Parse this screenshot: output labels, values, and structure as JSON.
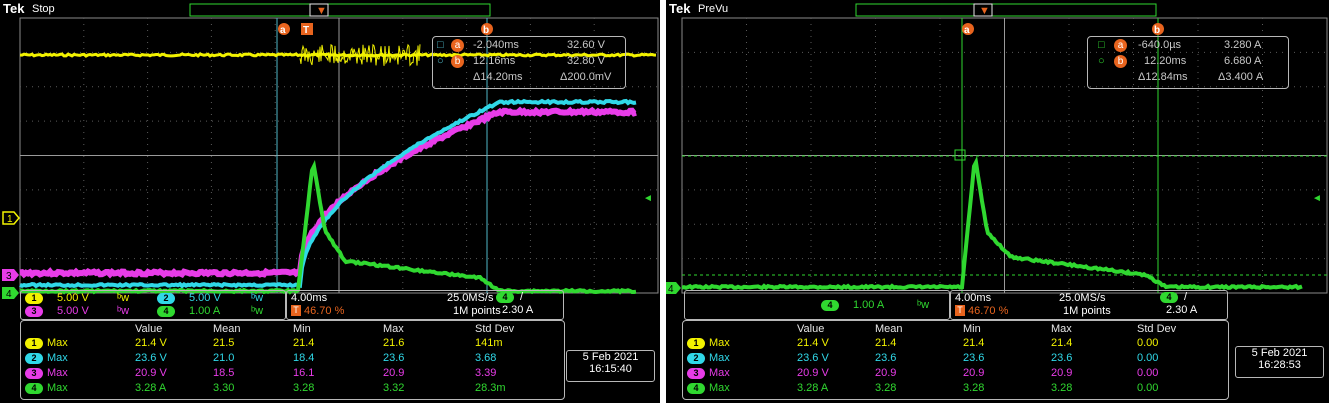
{
  "left": {
    "brand": "Tek",
    "acq_state": "Stop",
    "cursor_a": {
      "time": "-2.040ms",
      "value": "32.60 V"
    },
    "cursor_b": {
      "time": "12.16ms",
      "value": "32.80 V"
    },
    "cursor_delta": {
      "time": "Δ14.20ms",
      "value": "Δ200.0mV"
    },
    "ch_scales": [
      {
        "ch": "1",
        "label": "5.00 V",
        "color": "#f2f200"
      },
      {
        "ch": "2",
        "label": "5.00 V",
        "color": "#30d8e8"
      },
      {
        "ch": "3",
        "label": "5.00 V",
        "color": "#e83ce8"
      },
      {
        "ch": "4",
        "label": "1.00 A",
        "color": "#30d830"
      }
    ],
    "timebase": "4.00ms",
    "trigger_pos": "46.70 %",
    "sample_rate": "25.0MS/s",
    "record_length": "1M points",
    "trigger_ch": "4",
    "trigger_level": "2.30 A",
    "meas_headers": [
      "Value",
      "Mean",
      "Min",
      "Max",
      "Std Dev"
    ],
    "meas_rows": [
      {
        "ch": "1",
        "type": "Max",
        "value": "21.4 V",
        "mean": "21.5",
        "min": "21.4",
        "max": "21.6",
        "std": "141m",
        "color": "#f2f200"
      },
      {
        "ch": "2",
        "type": "Max",
        "value": "23.6 V",
        "mean": "21.0",
        "min": "18.4",
        "max": "23.6",
        "std": "3.68",
        "color": "#30d8e8"
      },
      {
        "ch": "3",
        "type": "Max",
        "value": "20.9 V",
        "mean": "18.5",
        "min": "16.1",
        "max": "20.9",
        "std": "3.39",
        "color": "#e83ce8"
      },
      {
        "ch": "4",
        "type": "Max",
        "value": "3.28 A",
        "mean": "3.30",
        "min": "3.28",
        "max": "3.32",
        "std": "28.3m",
        "color": "#30d830"
      }
    ],
    "date": "5 Feb  2021",
    "time": "16:15:40"
  },
  "right": {
    "brand": "Tek",
    "acq_state": "PreVu",
    "cursor_a": {
      "time": "-640.0µs",
      "value": "3.280 A"
    },
    "cursor_b": {
      "time": "12.20ms",
      "value": "6.680 A"
    },
    "cursor_delta": {
      "time": "Δ12.84ms",
      "value": "Δ3.400 A"
    },
    "ch_scale": {
      "ch": "4",
      "label": "1.00 A",
      "color": "#30d830"
    },
    "timebase": "4.00ms",
    "trigger_pos": "46.70 %",
    "sample_rate": "25.0MS/s",
    "record_length": "1M points",
    "trigger_ch": "4",
    "trigger_level": "2.30 A",
    "meas_headers": [
      "Value",
      "Mean",
      "Min",
      "Max",
      "Std Dev"
    ],
    "meas_rows": [
      {
        "ch": "1",
        "type": "Max",
        "value": "21.4 V",
        "mean": "21.4",
        "min": "21.4",
        "max": "21.4",
        "std": "0.00",
        "color": "#f2f200"
      },
      {
        "ch": "2",
        "type": "Max",
        "value": "23.6 V",
        "mean": "23.6",
        "min": "23.6",
        "max": "23.6",
        "std": "0.00",
        "color": "#30d8e8"
      },
      {
        "ch": "3",
        "type": "Max",
        "value": "20.9 V",
        "mean": "20.9",
        "min": "20.9",
        "max": "20.9",
        "std": "0.00",
        "color": "#e83ce8"
      },
      {
        "ch": "4",
        "type": "Max",
        "value": "3.28 A",
        "mean": "3.28",
        "min": "3.28",
        "max": "3.28",
        "std": "0.00",
        "color": "#30d830"
      }
    ],
    "date": "5 Feb  2021",
    "time": "16:28:53"
  },
  "marker_labels": {
    "a": "a",
    "b": "b",
    "t": "T",
    "ch1": "1",
    "ch3": "3",
    "ch4": "4"
  },
  "colors": {
    "ch1": "#f2f200",
    "ch2": "#30d8e8",
    "ch3": "#e83ce8",
    "ch4": "#30d830",
    "cursor": "#4fb8c8",
    "marker": "#e8641e",
    "grid": "#8a8a8a"
  }
}
